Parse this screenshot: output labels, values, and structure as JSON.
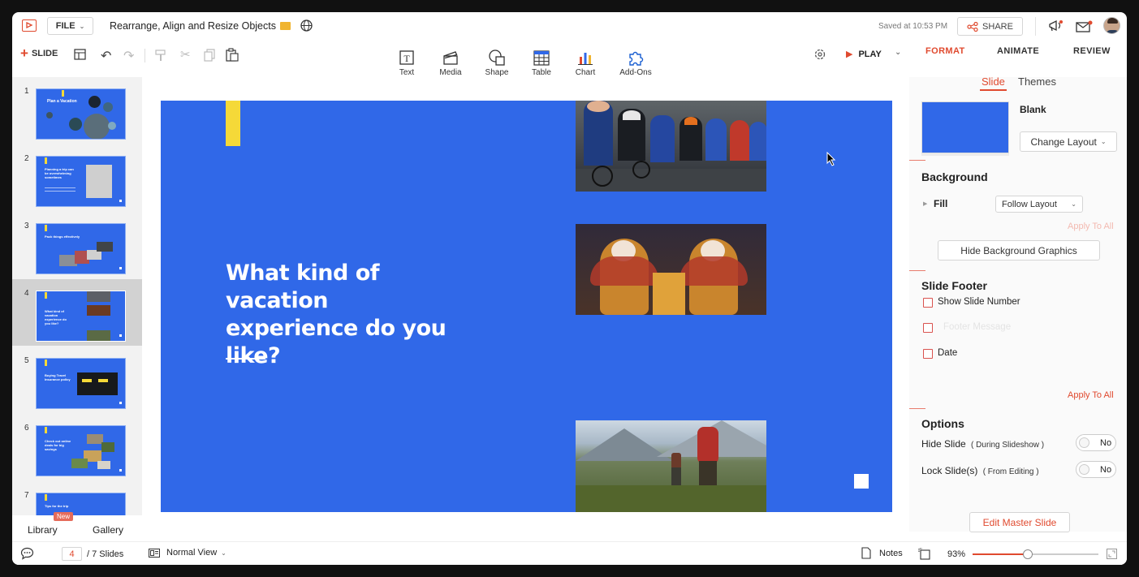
{
  "app": {
    "file_label": "FILE",
    "doc_title": "Rearrange, Align and Resize Objects",
    "saved_status": "Saved at 10:53 PM",
    "share_label": "SHARE"
  },
  "toolbar": {
    "slide_label": "SLIDE",
    "tools": [
      {
        "label": "Text",
        "icon": "text-box-icon"
      },
      {
        "label": "Media",
        "icon": "media-clapper-icon"
      },
      {
        "label": "Shape",
        "icon": "shape-icon"
      },
      {
        "label": "Table",
        "icon": "table-icon"
      },
      {
        "label": "Chart",
        "icon": "bar-chart-icon"
      },
      {
        "label": "Add-Ons",
        "icon": "puzzle-icon"
      }
    ],
    "play_label": "PLAY",
    "tabs": [
      "FORMAT",
      "ANIMATE",
      "REVIEW"
    ],
    "active_tab": "FORMAT"
  },
  "sidebar": {
    "slides": [
      {
        "num": "1",
        "title": "Plan a Vacation"
      },
      {
        "num": "2",
        "title": "Planning a trip can be overwhelming sometimes"
      },
      {
        "num": "3",
        "title": "Pack things effectively"
      },
      {
        "num": "4",
        "title": "What kind of vacation experience do you like?"
      },
      {
        "num": "5",
        "title": "Buying Travel Insurance policy"
      },
      {
        "num": "6",
        "title": "Check out online deals for big savings"
      },
      {
        "num": "7",
        "title": "Tips for the trip"
      }
    ],
    "library_label": "Library",
    "new_badge": "New",
    "gallery_label": "Gallery"
  },
  "slide": {
    "heading": "What kind of vacation experience do you like?"
  },
  "panel": {
    "subtabs": [
      "Slide",
      "Themes"
    ],
    "layout_name": "Blank",
    "change_layout": "Change Layout",
    "background_title": "Background",
    "fill_label": "Fill",
    "fill_value": "Follow Layout",
    "apply_to_all": "Apply To All",
    "hide_bg_graphics": "Hide Background Graphics",
    "footer_title": "Slide Footer",
    "show_slide_number": "Show Slide Number",
    "footer_message": "Footer Message",
    "date_label": "Date",
    "options_title": "Options",
    "hide_slide": "Hide Slide",
    "hide_slide_note": "( During Slideshow )",
    "lock_slide": "Lock Slide(s)",
    "lock_slide_note": "( From Editing )",
    "toggle_no": "No",
    "edit_master": "Edit Master Slide"
  },
  "status": {
    "current_slide": "4",
    "total_slides": "/ 7 Slides",
    "view_mode": "Normal View",
    "notes_label": "Notes",
    "zoom": "93%",
    "zoom_fraction": 0.44
  },
  "colors": {
    "accent_red": "#e04a2f",
    "slide_blue": "#3068e8",
    "highlight_yellow": "#f5d938"
  }
}
